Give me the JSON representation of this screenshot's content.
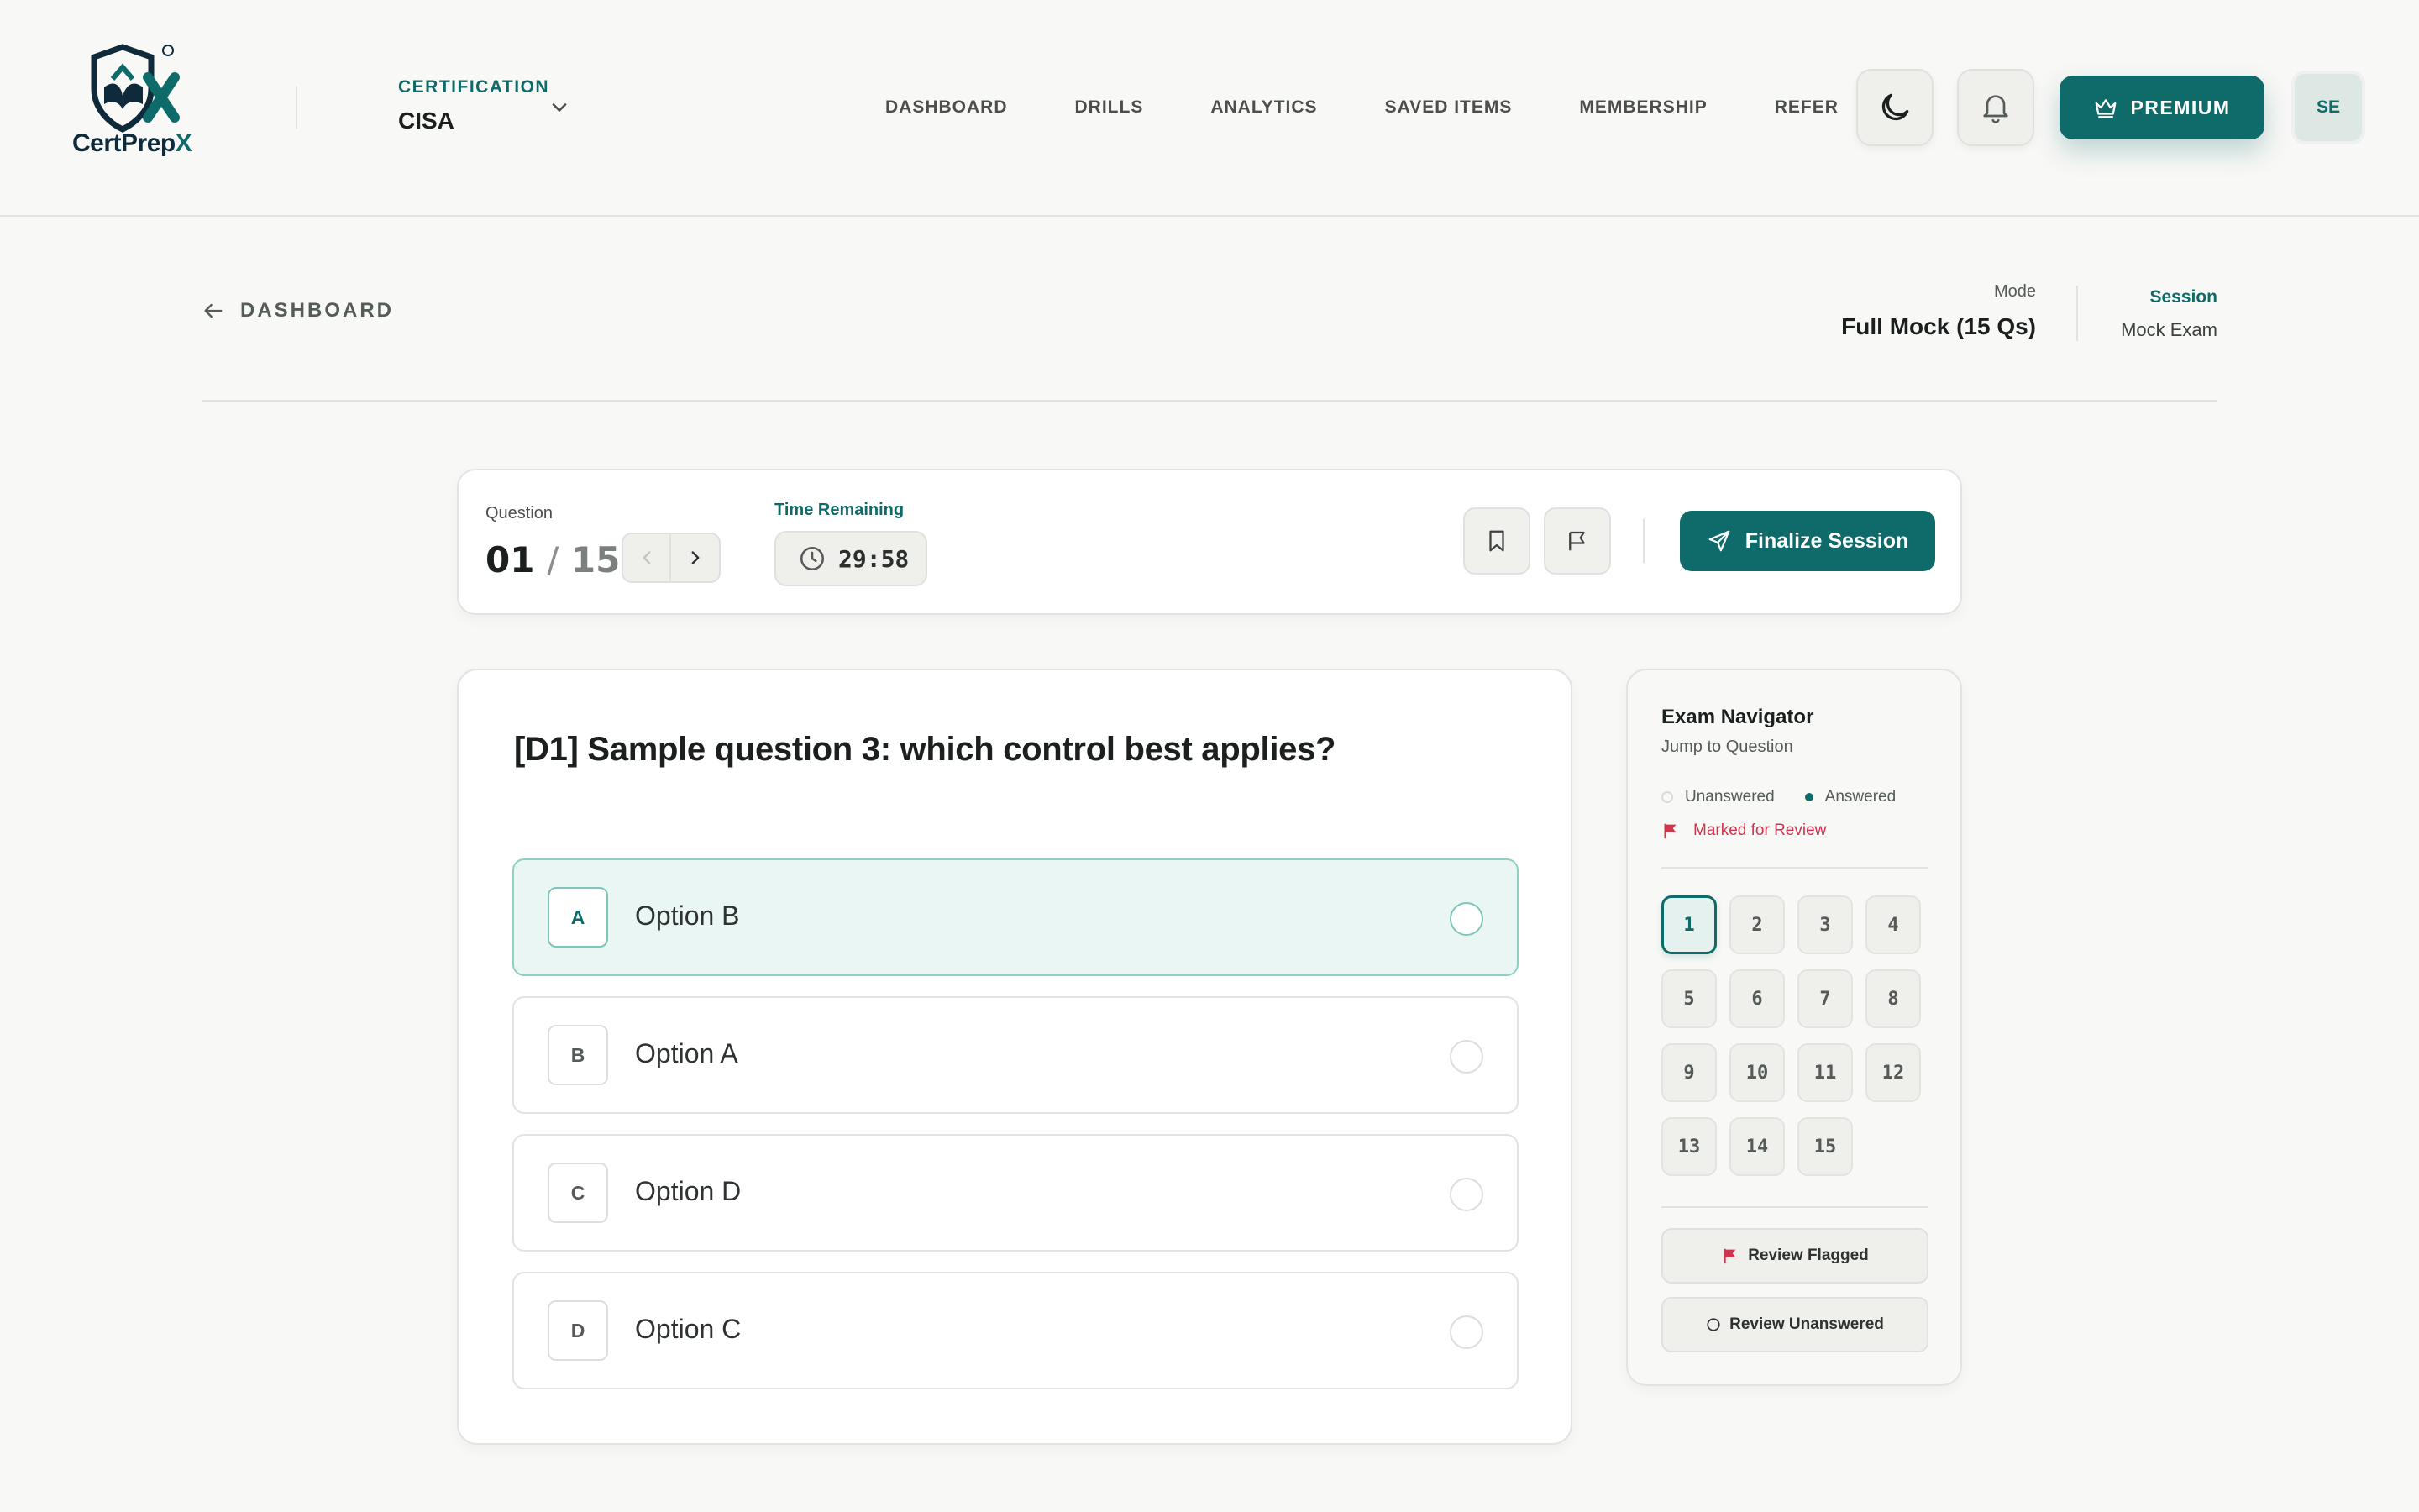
{
  "brand": {
    "name_prefix": "CertPrep",
    "name_suffix": "X"
  },
  "certification": {
    "label": "CERTIFICATION",
    "value": "CISA"
  },
  "nav": [
    {
      "label": "DASHBOARD"
    },
    {
      "label": "DRILLS"
    },
    {
      "label": "ANALYTICS"
    },
    {
      "label": "SAVED ITEMS"
    },
    {
      "label": "MEMBERSHIP"
    },
    {
      "label": "REFER"
    }
  ],
  "header": {
    "premium_label": "PREMIUM",
    "avatar_initials": "SE"
  },
  "back": {
    "label": "DASHBOARD"
  },
  "mode": {
    "label": "Mode",
    "value": "Full Mock (15 Qs)"
  },
  "session": {
    "label": "Session",
    "value": "Mock Exam"
  },
  "toolbar": {
    "question_label": "Question",
    "current": "01",
    "separator": "/",
    "total": "15",
    "time_label": "Time Remaining",
    "time_value": "29:58",
    "finalize_label": "Finalize Session"
  },
  "question": {
    "text": "[D1] Sample question 3: which control best applies?",
    "options": [
      {
        "letter": "A",
        "text": "Option B",
        "selected": true
      },
      {
        "letter": "B",
        "text": "Option A",
        "selected": false
      },
      {
        "letter": "C",
        "text": "Option D",
        "selected": false
      },
      {
        "letter": "D",
        "text": "Option C",
        "selected": false
      }
    ]
  },
  "navigator": {
    "title": "Exam Navigator",
    "subtitle": "Jump to Question",
    "legend_unanswered": "Unanswered",
    "legend_answered": "Answered",
    "legend_flagged": "Marked for Review",
    "numbers": [
      "1",
      "2",
      "3",
      "4",
      "5",
      "6",
      "7",
      "8",
      "9",
      "10",
      "11",
      "12",
      "13",
      "14",
      "15"
    ],
    "current": "1",
    "review_flagged": "Review Flagged",
    "review_unanswered": "Review Unanswered"
  },
  "colors": {
    "accent": "#0f6b6a",
    "flag": "#d1344f",
    "background": "#f8f8f6"
  }
}
